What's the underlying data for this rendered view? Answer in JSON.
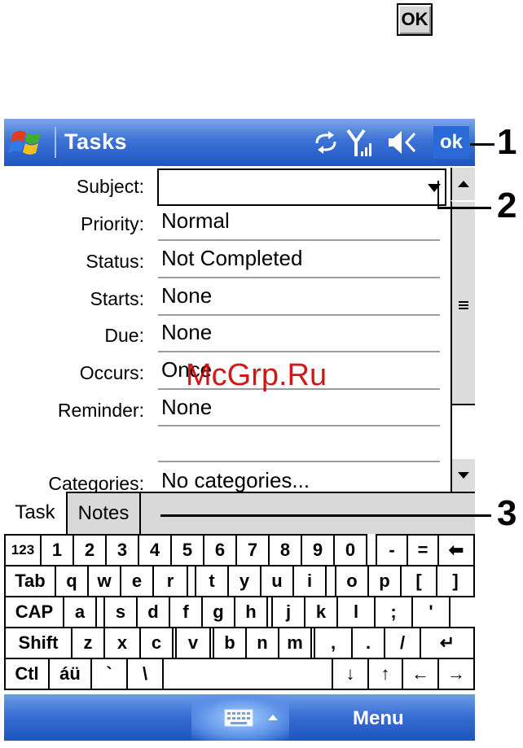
{
  "top_icon": {
    "label": "OK"
  },
  "titlebar": {
    "title": "Tasks",
    "ok_label": "ok"
  },
  "form": {
    "fields": [
      {
        "label": "Subject:",
        "value": ""
      },
      {
        "label": "Priority:",
        "value": "Normal"
      },
      {
        "label": "Status:",
        "value": "Not Completed"
      },
      {
        "label": "Starts:",
        "value": "None"
      },
      {
        "label": "Due:",
        "value": "None"
      },
      {
        "label": "Occurs:",
        "value": "Once"
      },
      {
        "label": "Reminder:",
        "value": "None"
      },
      {
        "label": "Categories:",
        "value": "No categories..."
      }
    ]
  },
  "tabs": [
    {
      "label": "Task"
    },
    {
      "label": "Notes"
    }
  ],
  "keyboard": {
    "rows": [
      [
        "123",
        "1",
        "2",
        "3",
        "4",
        "5",
        "6",
        "7",
        "8",
        "9",
        "0",
        "-",
        "=",
        "⬅"
      ],
      [
        "Tab",
        "q",
        "w",
        "e",
        "r",
        "t",
        "y",
        "u",
        "i",
        "o",
        "p",
        "[",
        "]"
      ],
      [
        "CAP",
        "a",
        "s",
        "d",
        "f",
        "g",
        "h",
        "j",
        "k",
        "l",
        ";",
        "'"
      ],
      [
        "Shift",
        "z",
        "x",
        "c",
        "v",
        "b",
        "n",
        "m",
        ",",
        ".",
        "/",
        "↵"
      ],
      [
        "Ctl",
        "áü",
        "`",
        "\\",
        "",
        "↓",
        "↑",
        "←",
        "→"
      ]
    ]
  },
  "menubar": {
    "menu_label": "Menu"
  },
  "callouts": [
    "1",
    "2",
    "3"
  ],
  "watermark": "McGrp.Ru",
  "colors": {
    "title_blue": "#2b69d7",
    "watermark_red": "#cc0000"
  }
}
